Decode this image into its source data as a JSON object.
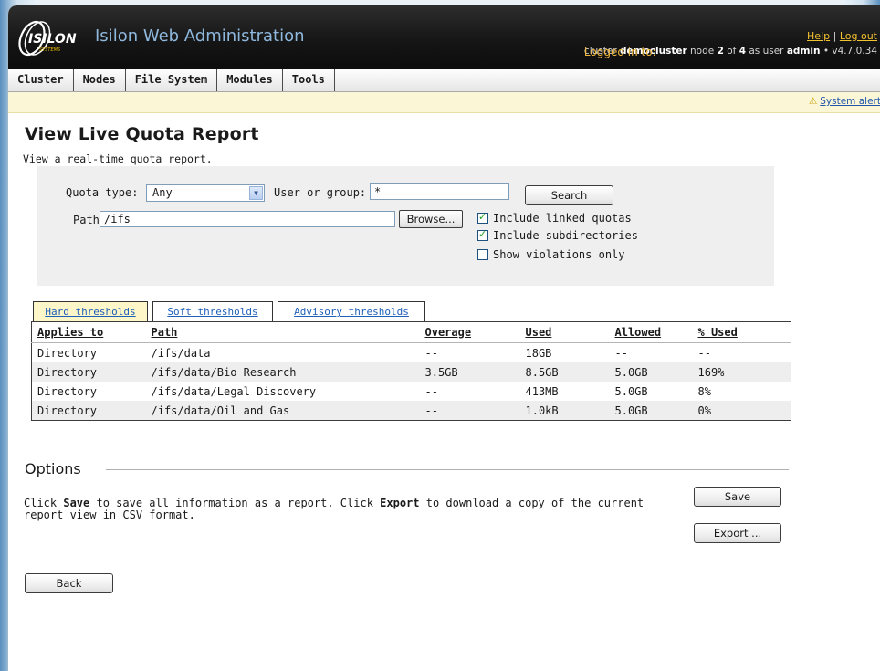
{
  "header": {
    "brand": "ISILON",
    "brand_sub": "SYSTEMS",
    "app_title": "Isilon Web Administration",
    "help_label": "Help",
    "separator": "|",
    "logout_label": "Log out",
    "login_prefix": "Logged in to:",
    "login_cluster_word": "cluster",
    "cluster_name": "democluster",
    "node_word": "node",
    "node_num": "2",
    "of_word": "of",
    "node_total": "4",
    "as_user_word": "as user",
    "user": "admin",
    "bullet": "•",
    "version": "v4.7.0.34"
  },
  "nav": {
    "items": [
      {
        "label": "Cluster"
      },
      {
        "label": "Nodes"
      },
      {
        "label": "File System"
      },
      {
        "label": "Modules"
      },
      {
        "label": "Tools"
      }
    ]
  },
  "alert": {
    "label": "System alert"
  },
  "page": {
    "title": "View Live Quota Report",
    "subtitle": "View a real-time quota report."
  },
  "search": {
    "quota_type_label": "Quota type:",
    "quota_type_value": "Any",
    "user_group_label": "User or group:",
    "user_group_value": "*",
    "search_button": "Search",
    "path_label": "Path:",
    "path_value": "/ifs",
    "browse_button": "Browse...",
    "include_linked_label": "Include linked quotas",
    "include_subdirs_label": "Include subdirectories",
    "violations_only_label": "Show violations only",
    "include_linked_checked": true,
    "include_subdirs_checked": true,
    "violations_only_checked": false
  },
  "tabs": [
    {
      "label": "Hard thresholds",
      "active": true
    },
    {
      "label": "Soft thresholds",
      "active": false
    },
    {
      "label": "Advisory thresholds",
      "active": false
    }
  ],
  "table": {
    "headers": [
      "Applies to",
      "Path",
      "Overage",
      "Used",
      "Allowed",
      "% Used"
    ],
    "rows": [
      [
        "Directory",
        "/ifs/data",
        "--",
        "18GB",
        "--",
        "--"
      ],
      [
        "Directory",
        "/ifs/data/Bio Research",
        "3.5GB",
        "8.5GB",
        "5.0GB",
        "169%"
      ],
      [
        "Directory",
        "/ifs/data/Legal Discovery",
        "--",
        "413MB",
        "5.0GB",
        "8%"
      ],
      [
        "Directory",
        "/ifs/data/Oil and Gas",
        "--",
        "1.0kB",
        "5.0GB",
        "0%"
      ]
    ]
  },
  "options": {
    "title": "Options",
    "text_part1": "Click ",
    "save_word": "Save",
    "text_part2": " to save all information as a report. Click ",
    "export_word": "Export",
    "text_part3": " to download a copy of the current report view in CSV format.",
    "save_button": "Save",
    "export_button": "Export ..."
  },
  "footer": {
    "back_button": "Back"
  }
}
